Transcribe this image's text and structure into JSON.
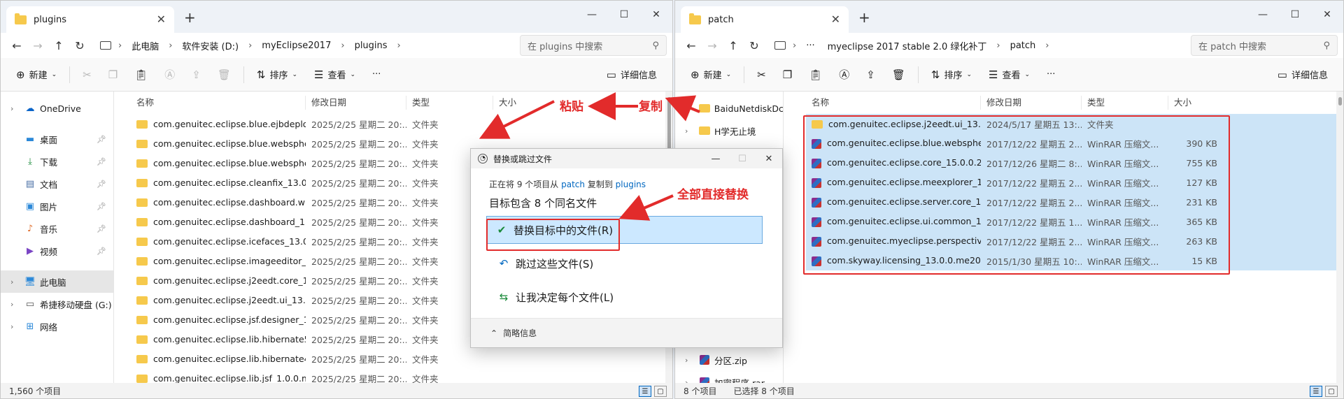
{
  "left": {
    "tab_title": "plugins",
    "breadcrumb": [
      "此电脑",
      "软件安装 (D:)",
      "myEclipse2017",
      "plugins"
    ],
    "search_placeholder": "在 plugins 中搜索",
    "toolbar": {
      "new": "新建",
      "sort": "排序",
      "view": "查看",
      "more": "···",
      "details": "详细信息"
    },
    "nav": [
      {
        "label": "OneDrive",
        "icon": "cloud-icon"
      },
      {
        "label": "桌面",
        "icon": "desktop-icon"
      },
      {
        "label": "下载",
        "icon": "download-icon"
      },
      {
        "label": "文档",
        "icon": "document-icon"
      },
      {
        "label": "图片",
        "icon": "picture-icon"
      },
      {
        "label": "音乐",
        "icon": "music-icon"
      },
      {
        "label": "视频",
        "icon": "video-icon"
      },
      {
        "label": "此电脑",
        "icon": "computer-icon"
      },
      {
        "label": "希捷移动硬盘 (G:)",
        "icon": "drive-icon"
      },
      {
        "label": "网络",
        "icon": "network-icon"
      }
    ],
    "columns": {
      "name": "名称",
      "date": "修改日期",
      "type": "类型",
      "size": "大小"
    },
    "rows": [
      {
        "name": "com.genuitec.eclipse.blue.ejbdeploy_...",
        "date": "2025/2/25 星期二 20:...",
        "type": "文件夹"
      },
      {
        "name": "com.genuitec.eclipse.blue.websphere...",
        "date": "2025/2/25 星期二 20:...",
        "type": "文件夹"
      },
      {
        "name": "com.genuitec.eclipse.blue.websphere...",
        "date": "2025/2/25 星期二 20:...",
        "type": "文件夹"
      },
      {
        "name": "com.genuitec.eclipse.cleanfix_13.0.0....",
        "date": "2025/2/25 星期二 20:...",
        "type": "文件夹"
      },
      {
        "name": "com.genuitec.eclipse.dashboard.wiza...",
        "date": "2025/2/25 星期二 20:...",
        "type": "文件夹"
      },
      {
        "name": "com.genuitec.eclipse.dashboard_13.0....",
        "date": "2025/2/25 星期二 20:...",
        "type": "文件夹"
      },
      {
        "name": "com.genuitec.eclipse.icefaces_13.0.0....",
        "date": "2025/2/25 星期二 20:...",
        "type": "文件夹"
      },
      {
        "name": "com.genuitec.eclipse.imageeditor_13....",
        "date": "2025/2/25 星期二 20:...",
        "type": "文件夹"
      },
      {
        "name": "com.genuitec.eclipse.j2eedt.core_13.0...",
        "date": "2025/2/25 星期二 20:...",
        "type": "文件夹"
      },
      {
        "name": "com.genuitec.eclipse.j2eedt.ui_13.0.0....",
        "date": "2025/2/25 星期二 20:...",
        "type": "文件夹"
      },
      {
        "name": "com.genuitec.eclipse.jsf.designer_13....",
        "date": "2025/2/25 星期二 20:...",
        "type": "文件夹"
      },
      {
        "name": "com.genuitec.eclipse.lib.hibernate5_1...",
        "date": "2025/2/25 星期二 20:...",
        "type": "文件夹"
      },
      {
        "name": "com.genuitec.eclipse.lib.hibernate41_...",
        "date": "2025/2/25 星期二 20:...",
        "type": "文件夹"
      },
      {
        "name": "com.genuitec.eclipse.lib.jsf_1.0.0.me2...",
        "date": "2025/2/25 星期二 20:...",
        "type": "文件夹"
      }
    ],
    "status": "1,560 个项目"
  },
  "right": {
    "tab_title": "patch",
    "breadcrumb": [
      "···",
      "myeclipse 2017 stable 2.0 绿化补丁",
      "patch"
    ],
    "search_placeholder": "在 patch 中搜索",
    "toolbar": {
      "new": "新建",
      "sort": "排序",
      "view": "查看",
      "more": "···",
      "details": "详细信息"
    },
    "nav": [
      {
        "label": "BaiduNetdiskDc",
        "icon": "folder-icon"
      },
      {
        "label": "H学无止境",
        "icon": "folder-icon"
      },
      {
        "label": "分区.zip",
        "icon": "archive-icon"
      },
      {
        "label": "加密程序.rar",
        "icon": "archive-icon"
      }
    ],
    "columns": {
      "name": "名称",
      "date": "修改日期",
      "type": "类型",
      "size": "大小"
    },
    "rows": [
      {
        "name": "com.genuitec.eclipse.j2eedt.ui_13.0.0....",
        "date": "2024/5/17 星期五 13:...",
        "type": "文件夹",
        "size": "",
        "kind": "folder"
      },
      {
        "name": "com.genuitec.eclipse.blue.websphere....",
        "date": "2017/12/22 星期五 2...",
        "type": "WinRAR 压缩文...",
        "size": "390 KB",
        "kind": "rar"
      },
      {
        "name": "com.genuitec.eclipse.core_15.0.0.201...",
        "date": "2017/12/26 星期二 8:...",
        "type": "WinRAR 压缩文...",
        "size": "755 KB",
        "kind": "rar"
      },
      {
        "name": "com.genuitec.eclipse.meexplorer_13....",
        "date": "2017/12/22 星期五 2...",
        "type": "WinRAR 压缩文...",
        "size": "127 KB",
        "kind": "rar"
      },
      {
        "name": "com.genuitec.eclipse.server.core_13.0...",
        "date": "2017/12/22 星期五 2...",
        "type": "WinRAR 压缩文...",
        "size": "231 KB",
        "kind": "rar"
      },
      {
        "name": "com.genuitec.eclipse.ui.common_13.0....",
        "date": "2017/12/22 星期五 1...",
        "type": "WinRAR 压缩文...",
        "size": "365 KB",
        "kind": "rar"
      },
      {
        "name": "com.genuitec.myeclipse.perspective_...",
        "date": "2017/12/22 星期五 2...",
        "type": "WinRAR 压缩文...",
        "size": "263 KB",
        "kind": "rar"
      },
      {
        "name": "com.skyway.licensing_13.0.0.me20140...",
        "date": "2015/1/30 星期五 10:...",
        "type": "WinRAR 压缩文...",
        "size": "15 KB",
        "kind": "rar"
      }
    ],
    "status_count": "8 个项目",
    "status_selected": "已选择 8 个项目"
  },
  "dialog": {
    "title": "替换或跳过文件",
    "line1_prefix": "正在将 9 个项目从",
    "line1_src": "patch",
    "line1_mid": "复制到",
    "line1_dst": "plugins",
    "line2": "目标包含 8 个同名文件",
    "options": [
      "替换目标中的文件(R)",
      "跳过这些文件(S)",
      "让我决定每个文件(L)"
    ],
    "footer": "简略信息"
  },
  "annotations": {
    "paste": "粘贴",
    "copy": "复制",
    "replace_all": "全部直接替换"
  },
  "colors": {
    "annotation": "#e22b2b",
    "accent": "#0067c0",
    "folder": "#f6c94c",
    "selection": "#cce4f7"
  }
}
